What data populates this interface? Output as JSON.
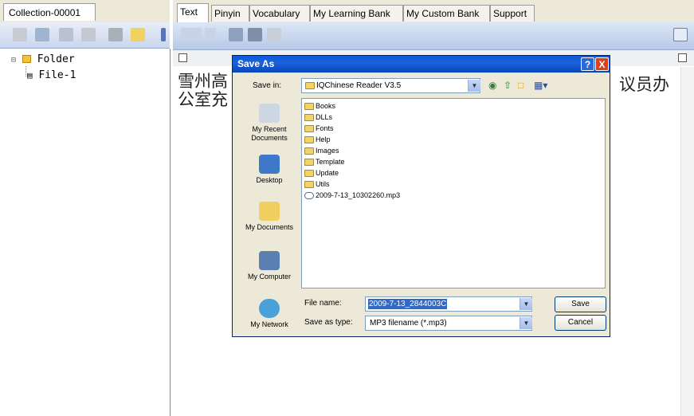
{
  "left_panel": {
    "collection_tab": "Collection-00001",
    "tree": {
      "folder": "Folder",
      "file": "File-1"
    }
  },
  "right_panel": {
    "tabs": [
      "Text",
      "Pinyin",
      "Vocabulary",
      "My Learning Bank",
      "My Custom Bank",
      "Support"
    ],
    "active_tab": "Text",
    "document": {
      "line1_left": "雪州高",
      "line1_right": "议员办",
      "line2_left": "公室充"
    }
  },
  "save_dialog": {
    "title": "Save As",
    "help_symbol": "?",
    "close_symbol": "X",
    "save_in_label": "Save in:",
    "save_in_value": "IQChinese Reader V3.5",
    "places": [
      "My Recent Documents",
      "Desktop",
      "My Documents",
      "My Computer",
      "My Network"
    ],
    "items": [
      {
        "name": "Books",
        "type": "folder"
      },
      {
        "name": "DLLs",
        "type": "folder"
      },
      {
        "name": "Fonts",
        "type": "folder"
      },
      {
        "name": "Help",
        "type": "folder"
      },
      {
        "name": "Images",
        "type": "folder"
      },
      {
        "name": "Template",
        "type": "folder"
      },
      {
        "name": "Update",
        "type": "folder"
      },
      {
        "name": "Utils",
        "type": "folder"
      },
      {
        "name": "2009-7-13_10302260.mp3",
        "type": "mp3"
      }
    ],
    "file_name_label": "File name:",
    "file_name_value": "2009-7-13_2844003C",
    "save_as_type_label": "Save as type:",
    "save_as_type_value": "MP3 filename (*.mp3)",
    "save_button": "Save",
    "cancel_button": "Cancel"
  },
  "colors": {
    "title_bar": "#0a58d8",
    "selection": "#316ac5",
    "dialog_bg": "#ece9d8",
    "folder": "#f2d36a"
  }
}
